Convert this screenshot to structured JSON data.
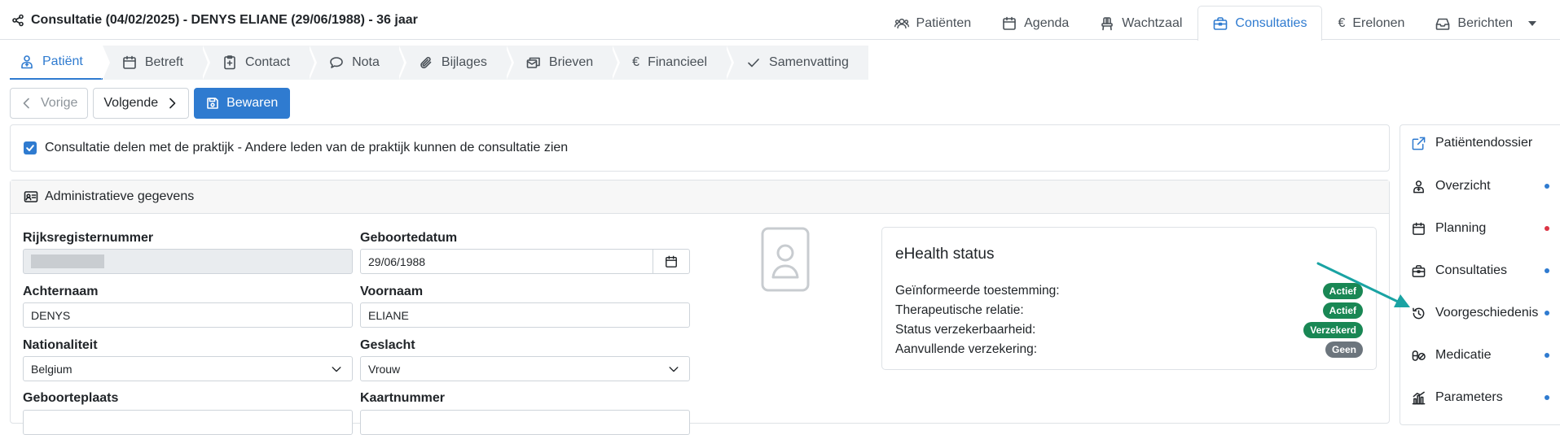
{
  "header": {
    "title": "Consultatie (04/02/2025) - DENYS ELIANE (29/06/1988) - 36 jaar",
    "tabs": [
      {
        "label": "Patiënten",
        "icon": "users-icon"
      },
      {
        "label": "Agenda",
        "icon": "calendar-icon"
      },
      {
        "label": "Wachtzaal",
        "icon": "chair-icon"
      },
      {
        "label": "Consultaties",
        "icon": "briefcase-icon",
        "active": true
      },
      {
        "label": "Erelonen",
        "icon": "euro-icon"
      },
      {
        "label": "Berichten",
        "icon": "inbox-icon"
      }
    ]
  },
  "subtabs": [
    {
      "label": "Patiënt",
      "active": true
    },
    {
      "label": "Betreft"
    },
    {
      "label": "Contact"
    },
    {
      "label": "Nota"
    },
    {
      "label": "Bijlages"
    },
    {
      "label": "Brieven"
    },
    {
      "label": "Financieel"
    },
    {
      "label": "Samenvatting"
    }
  ],
  "actions": {
    "prev": "Vorige",
    "next": "Volgende",
    "save": "Bewaren"
  },
  "share": {
    "label": "Consultatie delen met de praktijk - Andere leden van de praktijk kunnen de consultatie zien",
    "checked": true
  },
  "admin": {
    "title": "Administratieve gegevens",
    "fields": {
      "rijksregister": {
        "label": "Rijksregisternummer",
        "value": ""
      },
      "geboortedatum": {
        "label": "Geboortedatum",
        "value": "29/06/1988"
      },
      "achternaam": {
        "label": "Achternaam",
        "value": "DENYS"
      },
      "voornaam": {
        "label": "Voornaam",
        "value": "ELIANE"
      },
      "nationaliteit": {
        "label": "Nationaliteit",
        "value": "Belgium"
      },
      "geslacht": {
        "label": "Geslacht",
        "value": "Vrouw"
      },
      "geboorteplaats": {
        "label": "Geboorteplaats"
      },
      "kaartnummer": {
        "label": "Kaartnummer"
      }
    }
  },
  "ehealth": {
    "title": "eHealth status",
    "rows": [
      {
        "label": "Geïnformeerde toestemming:",
        "badge": "Actief",
        "color": "#198754"
      },
      {
        "label": "Therapeutische relatie:",
        "badge": "Actief",
        "color": "#198754"
      },
      {
        "label": "Status verzekerbaarheid:",
        "badge": "Verzekerd",
        "color": "#198754"
      },
      {
        "label": "Aanvullende verzekering:",
        "badge": "Geen",
        "color": "#6c757d"
      }
    ]
  },
  "sidebar": {
    "items": [
      {
        "label": "Patiëntendossier",
        "icon": "external-link-icon"
      },
      {
        "label": "Overzicht",
        "icon": "patient-icon",
        "dot": "#2f7bd0"
      },
      {
        "label": "Planning",
        "icon": "calendar-icon",
        "dot": "#dc3545"
      },
      {
        "label": "Consultaties",
        "icon": "briefcase-icon",
        "dot": "#2f7bd0"
      },
      {
        "label": "Voorgeschiedenis",
        "icon": "history-icon",
        "dot": "#2f7bd0"
      },
      {
        "label": "Medicatie",
        "icon": "pills-icon",
        "dot": "#2f7bd0"
      },
      {
        "label": "Parameters",
        "icon": "chart-icon",
        "dot": "#2f7bd0"
      }
    ]
  },
  "colors": {
    "accent": "#2f7bd0",
    "success": "#198754",
    "muted": "#6c757d",
    "annotation_arrow": "#1aa3a3"
  }
}
